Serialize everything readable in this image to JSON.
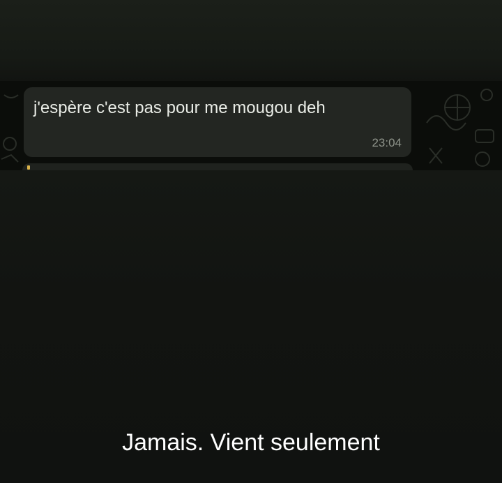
{
  "message": {
    "text": "j'espère c'est pas pour me mougou deh",
    "time": "23:04"
  },
  "caption": "Jamais. Vient seulement",
  "colors": {
    "background": "#121411",
    "chat_wallpaper": "#0b0d0a",
    "bubble": "#232622",
    "bubble_text": "#e9ece6",
    "timestamp": "#8e938a",
    "caption": "#ffffff"
  },
  "icons": [
    "chat-wallpaper-doodle-icon"
  ]
}
